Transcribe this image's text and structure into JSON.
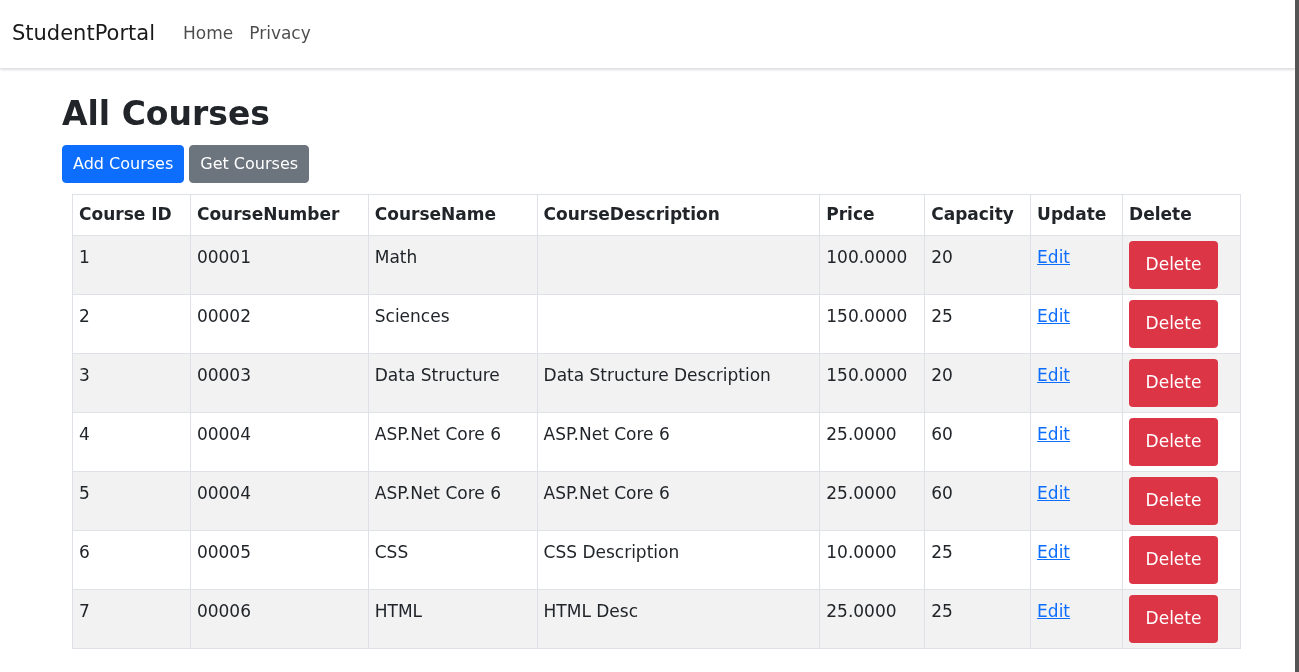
{
  "navbar": {
    "brand": "StudentPortal",
    "links": [
      "Home",
      "Privacy"
    ]
  },
  "page_title": "All Courses",
  "buttons": [
    {
      "label": "Add Courses",
      "kind": "primary"
    },
    {
      "label": "Get Courses",
      "kind": "secondary"
    }
  ],
  "table": {
    "columns": [
      "Course ID",
      "CourseNumber",
      "CourseName",
      "CourseDescription",
      "Price",
      "Capacity",
      "Update",
      "Delete"
    ],
    "rows": [
      {
        "id": "1",
        "number": "00001",
        "name": "Math",
        "description": "",
        "price": "100.0000",
        "capacity": "20",
        "edit": "Edit",
        "delete": "Delete"
      },
      {
        "id": "2",
        "number": "00002",
        "name": "Sciences",
        "description": "",
        "price": "150.0000",
        "capacity": "25",
        "edit": "Edit",
        "delete": "Delete"
      },
      {
        "id": "3",
        "number": "00003",
        "name": "Data Structure",
        "description": "Data Structure Description",
        "price": "150.0000",
        "capacity": "20",
        "edit": "Edit",
        "delete": "Delete"
      },
      {
        "id": "4",
        "number": "00004",
        "name": "ASP.Net Core 6",
        "description": "ASP.Net Core 6",
        "price": "25.0000",
        "capacity": "60",
        "edit": "Edit",
        "delete": "Delete"
      },
      {
        "id": "5",
        "number": "00004",
        "name": "ASP.Net Core 6",
        "description": "ASP.Net Core 6",
        "price": "25.0000",
        "capacity": "60",
        "edit": "Edit",
        "delete": "Delete"
      },
      {
        "id": "6",
        "number": "00005",
        "name": "CSS",
        "description": "CSS Description",
        "price": "10.0000",
        "capacity": "25",
        "edit": "Edit",
        "delete": "Delete"
      },
      {
        "id": "7",
        "number": "00006",
        "name": "HTML",
        "description": "HTML Desc",
        "price": "25.0000",
        "capacity": "25",
        "edit": "Edit",
        "delete": "Delete"
      }
    ]
  }
}
